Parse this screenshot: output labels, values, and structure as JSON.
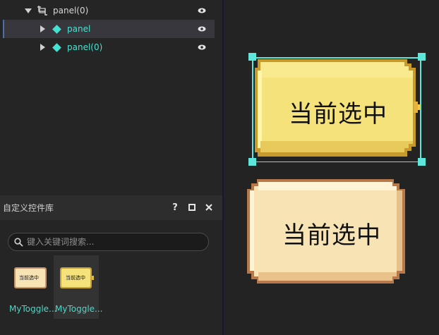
{
  "tree": {
    "items": [
      {
        "label": "panel(0)",
        "expanded": true,
        "type": "group"
      },
      {
        "label": "panel",
        "expanded": false,
        "type": "node",
        "selected": true
      },
      {
        "label": "panel(0)",
        "expanded": false,
        "type": "node",
        "selected": false
      }
    ]
  },
  "library": {
    "title": "自定义控件库",
    "help": "?",
    "maximize": "□",
    "close": "✕",
    "search_placeholder": "键入关键词搜索...",
    "items": [
      {
        "label": "MyToggle...",
        "thumb_text": "当前选中",
        "variant": "unselected"
      },
      {
        "label": "MyToggle...",
        "thumb_text": "当前选中",
        "variant": "selected"
      }
    ]
  },
  "canvas": {
    "toggle_selected_text": "当前选中",
    "toggle_unselected_text": "当前选中"
  },
  "colors": {
    "accent": "#5ee6da",
    "selected_fill": "#f5e27a",
    "unselected_fill": "#f7e3b4"
  }
}
